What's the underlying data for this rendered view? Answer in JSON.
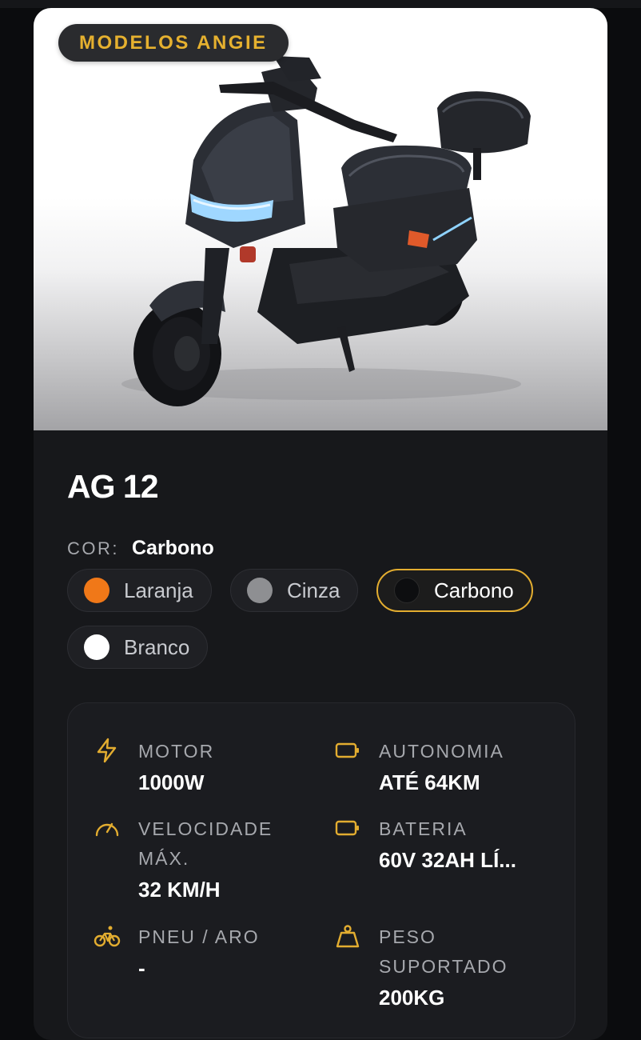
{
  "badge": "MODELOS ANGIE",
  "product": {
    "name": "AG 12",
    "color_label": "COR:",
    "color_selected": "Carbono"
  },
  "colors": [
    {
      "label": "Laranja",
      "swatch": "#f07818",
      "selected": false
    },
    {
      "label": "Cinza",
      "swatch": "#8e8f92",
      "selected": false
    },
    {
      "label": "Carbono",
      "swatch": "#0d0e10",
      "selected": true
    },
    {
      "label": "Branco",
      "swatch": "#ffffff",
      "selected": false
    }
  ],
  "accent": "#e3ad30",
  "specs": {
    "motor": {
      "label": "MOTOR",
      "value": "1000W",
      "icon": "bolt-icon"
    },
    "autonomia": {
      "label": "AUTONOMIA",
      "value": "ATÉ 64KM",
      "icon": "battery-icon"
    },
    "velocidade": {
      "label": "VELOCIDADE MÁX.",
      "value": "32 KM/H",
      "icon": "speedometer-icon"
    },
    "bateria": {
      "label": "BATERIA",
      "value": "60V 32AH LÍ...",
      "icon": "battery-icon"
    },
    "pneu": {
      "label": "PNEU / ARO",
      "value": "-",
      "icon": "bicycle-icon"
    },
    "peso": {
      "label": "PESO SUPORTADO",
      "value": "200KG",
      "icon": "weight-icon"
    }
  }
}
